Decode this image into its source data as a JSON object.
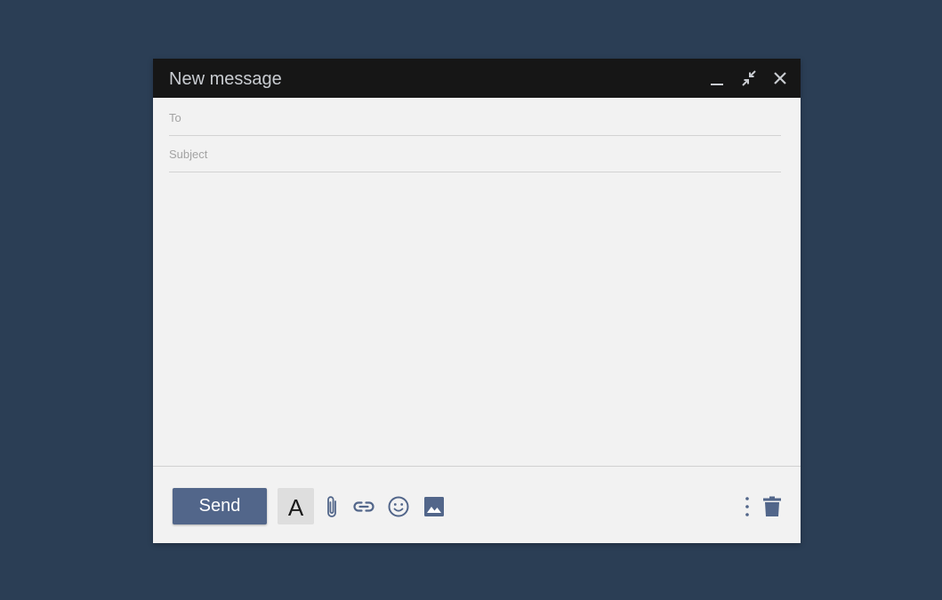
{
  "compose": {
    "title": "New message",
    "to_placeholder": "To",
    "subject_placeholder": "Subject",
    "body_value": "",
    "send_label": "Send",
    "format_label": "A"
  },
  "icons": {
    "minimize": "minimize-icon",
    "exit_fullscreen": "exit-fullscreen-icon",
    "close": "close-icon",
    "attach": "paperclip-icon",
    "link": "link-icon",
    "emoji": "smiley-icon",
    "image": "image-icon",
    "more": "more-vertical-icon",
    "delete": "trash-icon"
  },
  "colors": {
    "background": "#2b3e55",
    "header": "#161616",
    "accent": "#52668a",
    "panel": "#f2f2f2"
  }
}
